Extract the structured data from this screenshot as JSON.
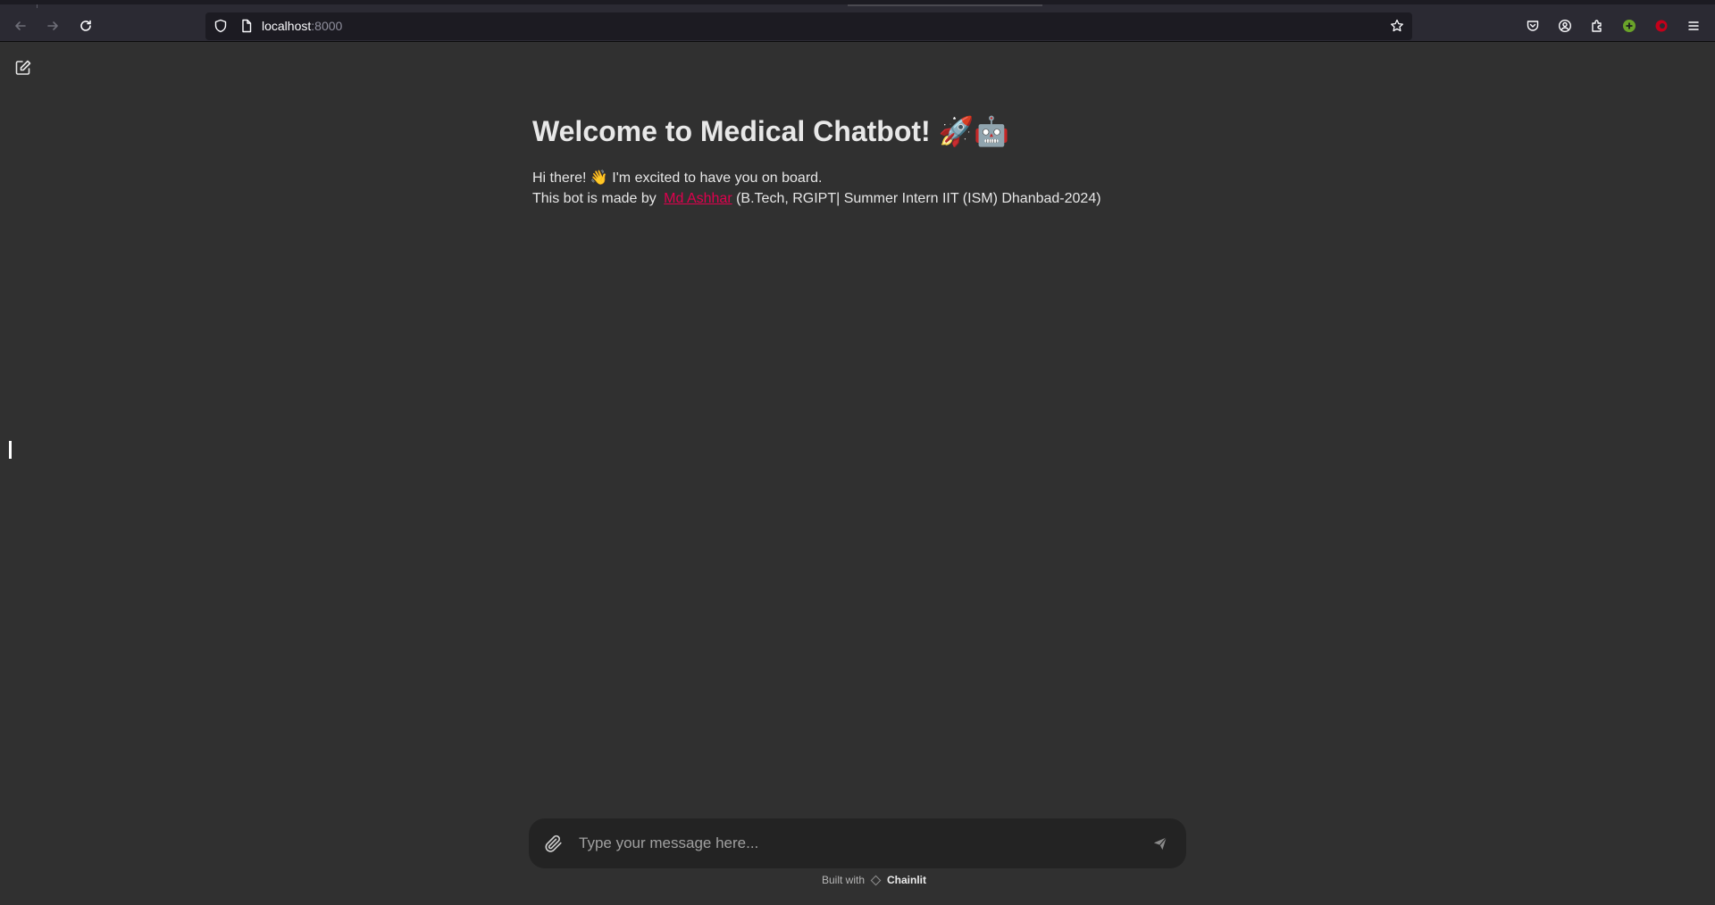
{
  "browser": {
    "url_host": "localhost",
    "url_port": ":8000",
    "icons": [
      "back-icon",
      "forward-icon",
      "reload-icon",
      "shield-icon",
      "page-icon",
      "bookmark-star-icon",
      "pocket-icon",
      "account-icon",
      "extensions-icon",
      "extension-plus-icon",
      "extension-record-icon",
      "menu-icon"
    ]
  },
  "sidebar": {
    "new_chat_icon": "edit-icon"
  },
  "welcome": {
    "title": "Welcome to Medical Chatbot! ",
    "title_emojis": "🚀🤖",
    "greeting_start": "Hi there! ",
    "greeting_emoji": "👋",
    "greeting_end": " I'm excited to have you on board.",
    "made_by_prefix": "This bot is made by ",
    "author_name": "Md Ashhar",
    "made_by_suffix": " (B.Tech, RGIPT| Summer Intern IIT (ISM) Dhanbad-2024)"
  },
  "composer": {
    "placeholder": "Type your message here...",
    "attach_icon": "paperclip-icon",
    "send_icon": "send-icon"
  },
  "footer": {
    "built_with": "Built with",
    "brand": "Chainlit"
  },
  "colors": {
    "page_bg": "#303030",
    "composer_bg": "#232323",
    "link": "#e0004e",
    "chrome_bg": "#2b2a33",
    "urlbar_bg": "#1c1b22"
  }
}
